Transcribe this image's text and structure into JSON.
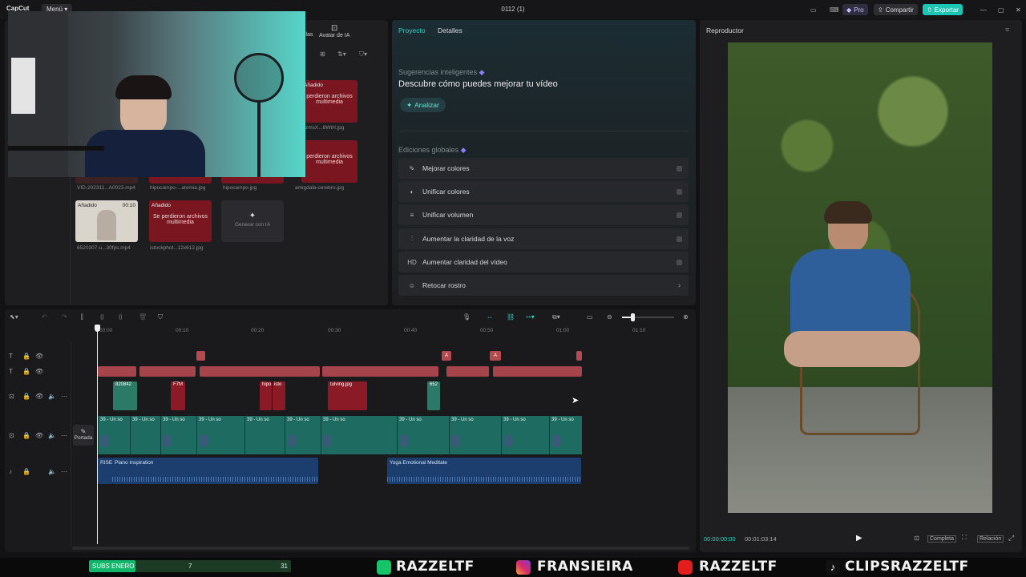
{
  "titlebar": {
    "app_name": "CapCut",
    "menu_label": "Menú",
    "project_title": "0112 (1)",
    "pro_label": "Pro",
    "share_label": "Compartir",
    "export_label": "Exportar"
  },
  "media": {
    "tab_label": "Avatar de IA",
    "tab_prefix": "llas",
    "items": [
      {
        "tag": "Añadido",
        "text": "perdieron archivos multimedia",
        "caption": "zmsX...8WtH.jpg"
      },
      {
        "tag": "",
        "text": "perdieron archivos multimedia",
        "caption": "amigdala-cerebro.jpg"
      },
      {
        "tag": "",
        "text": "",
        "caption": "VID-202311...A0023.mp4"
      },
      {
        "tag": "",
        "text": "",
        "caption": "hipocampo-...atomia.jpg"
      },
      {
        "tag": "",
        "text": "",
        "caption": "hipocampo.jpg"
      },
      {
        "tag": "Añadido",
        "duration": "00:10",
        "text": "",
        "caption": "6520307-u...30fps.mp4"
      },
      {
        "tag": "Añadido",
        "text": "Se perdieron archivos multimedia",
        "caption": "istockphot...12x612.jpg"
      }
    ],
    "generate_label": "Generar con IA"
  },
  "project": {
    "tab_project": "Proyecto",
    "tab_details": "Detalles",
    "smart_title": "Sugerencias inteligentes",
    "smart_heading": "Descubre cómo puedes mejorar tu vídeo",
    "analyze_label": "Analizar",
    "global_title": "Ediciones globales",
    "rows": [
      {
        "icon": "✎",
        "label": "Mejorar colores"
      },
      {
        "icon": "◐",
        "label": "Unificar colores"
      },
      {
        "icon": "≡",
        "label": "Unificar volumen"
      },
      {
        "icon": "⫶",
        "label": "Aumentar la claridad de la voz"
      },
      {
        "icon": "HD",
        "label": "Aumentar claridad del vídeo"
      },
      {
        "icon": "☺",
        "label": "Retocar rostro"
      }
    ]
  },
  "player": {
    "title": "Reproductor",
    "current_time": "00:00:00:00",
    "total_time": "00:01:03:14",
    "complete_label": "Completa",
    "ratio_label": "Relación"
  },
  "timeline": {
    "ruler": [
      "00:00",
      "00:10",
      "00:20",
      "00:30",
      "00:40",
      "00:50",
      "01:00",
      "01:10"
    ],
    "cover_label": "Portada",
    "sticker_labels": [
      "820842",
      "F7M",
      "hipo",
      "isto",
      "tulving.jpg",
      "652"
    ],
    "video_label": "39 - Un so",
    "audio_clips": [
      {
        "label": "RISE"
      },
      {
        "label": "Piano Inspiration"
      },
      {
        "label": "Yoga Emotional Meditate"
      }
    ]
  },
  "banner": {
    "subs_label": "SUBS ENERO",
    "subs_current": "7",
    "subs_goal": "31",
    "subs_progress": 0.23,
    "handles": [
      "RAZZELTF",
      "FRANSIEIRA",
      "RAZZELTF",
      "CLIPSRAZZELTF"
    ]
  },
  "colors": {
    "accent": "#2bd4c4",
    "export": "#1bc6b4",
    "missing_media": "#7a1620",
    "video_track": "#1e6b62",
    "audio_track": "#1c3e6e"
  }
}
